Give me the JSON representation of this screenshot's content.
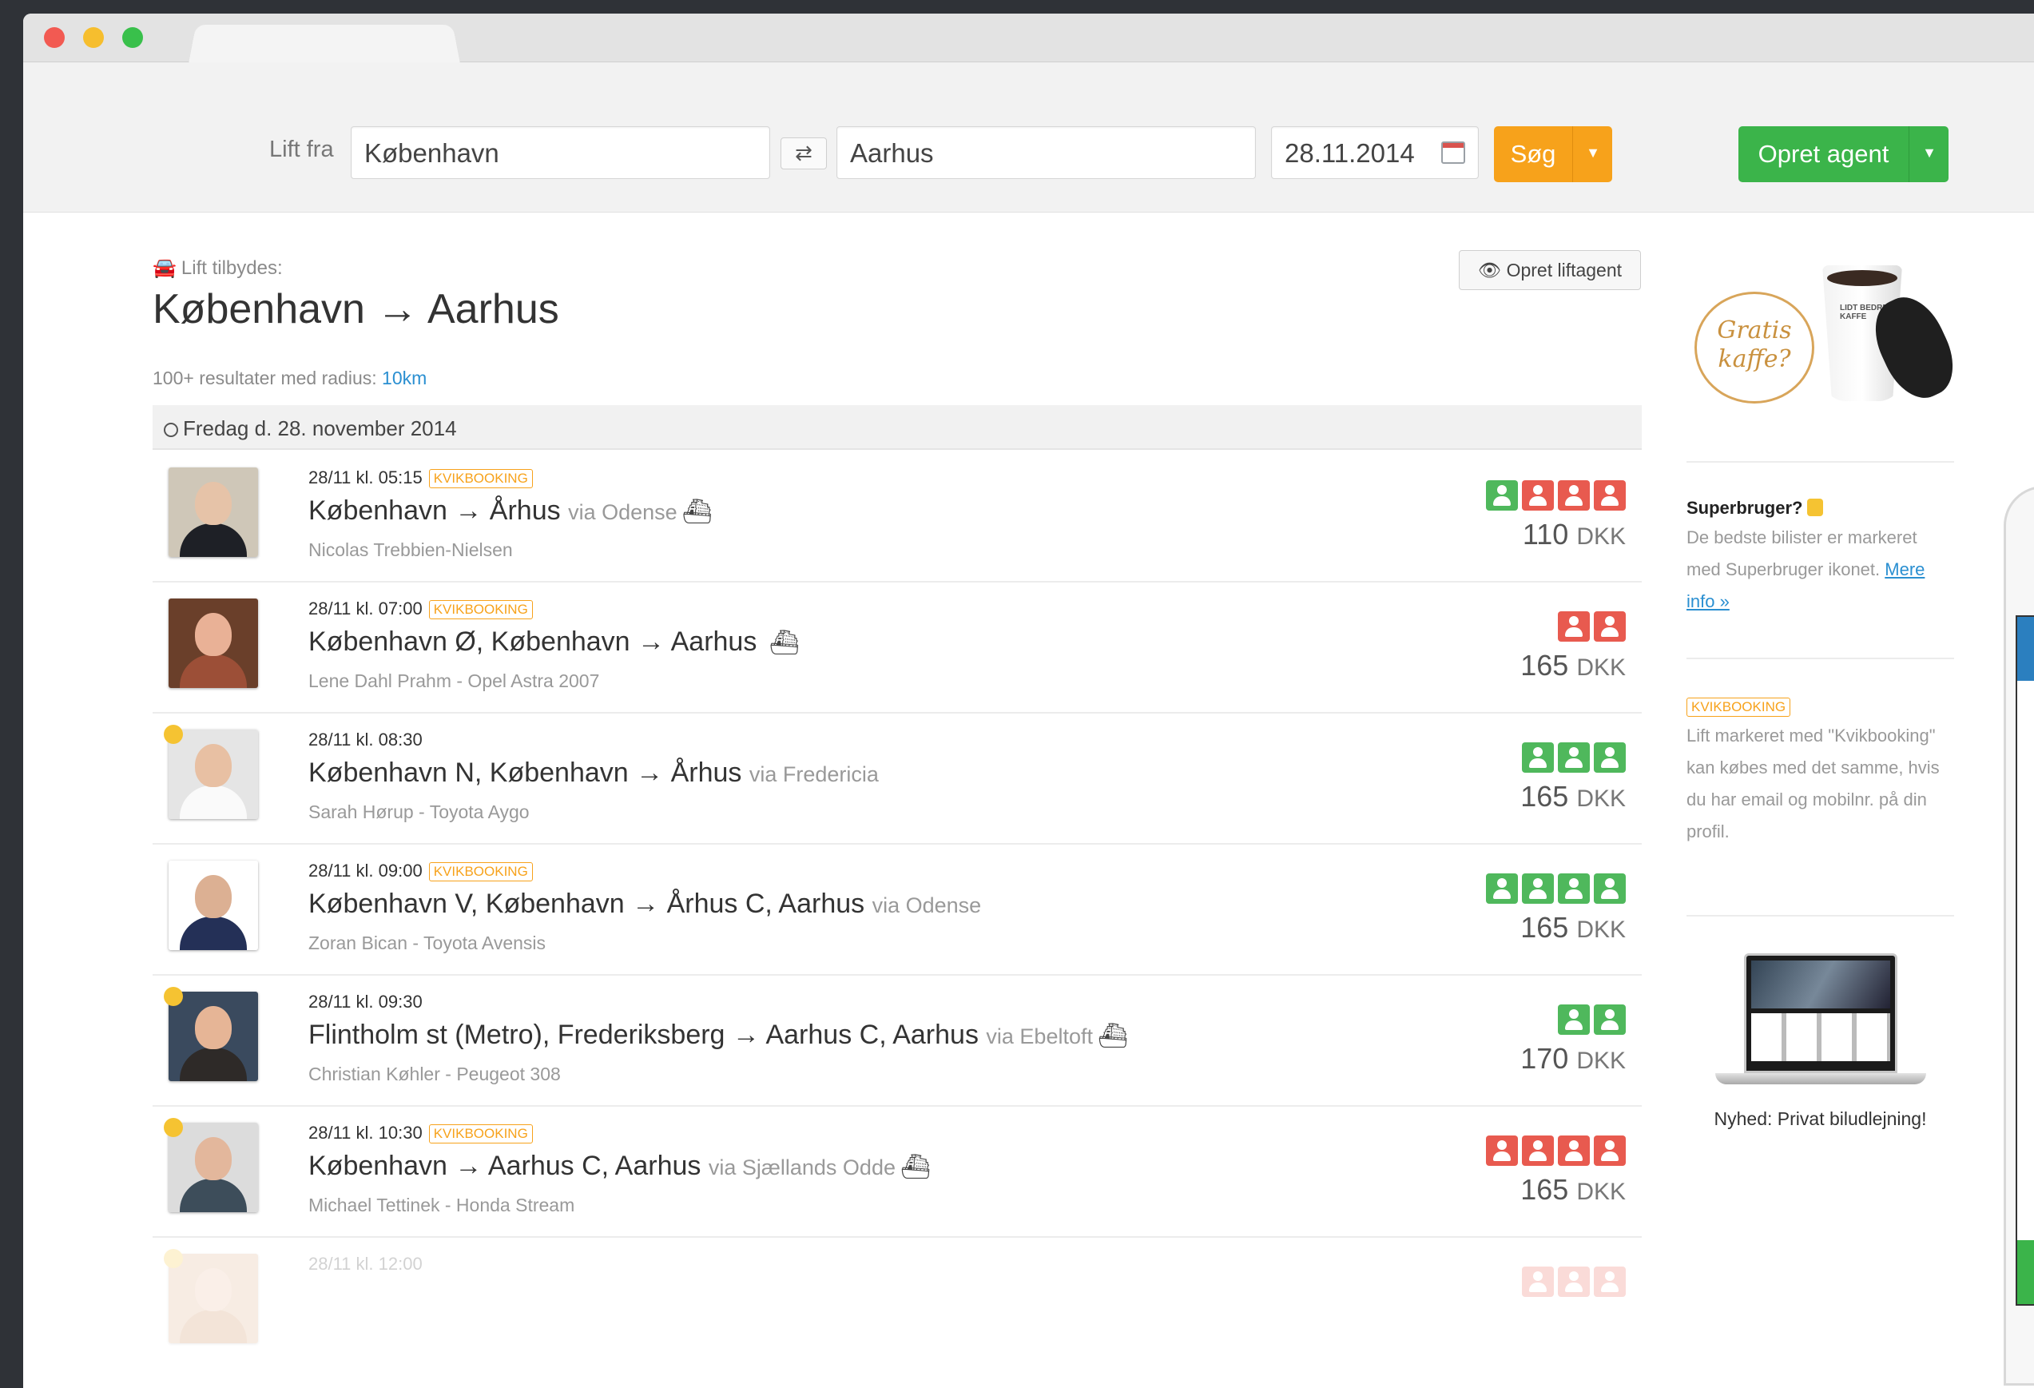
{
  "search": {
    "label": "Lift fra",
    "from_value": "København",
    "to_value": "Aarhus",
    "date_value": "28.11.2014",
    "search_label": "Søg",
    "agent_label": "Opret agent",
    "swap_icon": "⇄"
  },
  "header": {
    "offered_label": "Lift tilbydes:",
    "route_title": "København → Aarhus",
    "result_prefix": "100+ resultater med radius:",
    "radius": "10km",
    "liftagent_label": "Opret liftagent",
    "date_heading": "Fredag d. 28. november 2014"
  },
  "rides": [
    {
      "time": "28/11 kl. 05:15",
      "kvik": "KVIKBOOKING",
      "route": "København → Århus",
      "via": "via Odense",
      "ferry": true,
      "driver": "Nicolas Trebbien-Nielsen",
      "seats": [
        "free",
        "taken",
        "taken",
        "taken"
      ],
      "price": "110",
      "currency": "DKK",
      "super": false,
      "avatar_colors": {
        "bg": "#cfc7b8",
        "head": "#e6c3a8",
        "body": "#1e2026"
      }
    },
    {
      "time": "28/11 kl. 07:00",
      "kvik": "KVIKBOOKING",
      "route": "København Ø, København → Aarhus",
      "via": "",
      "ferry": true,
      "driver": "Lene Dahl Prahm - Opel Astra 2007",
      "seats": [
        "taken",
        "taken"
      ],
      "price": "165",
      "currency": "DKK",
      "super": false,
      "avatar_colors": {
        "bg": "#6a3f2a",
        "head": "#e9b196",
        "body": "#9c4f37"
      }
    },
    {
      "time": "28/11 kl. 08:30",
      "kvik": "",
      "route": "København N, København → Århus",
      "via": "via Fredericia",
      "ferry": false,
      "driver": "Sarah Hørup - Toyota Aygo",
      "seats": [
        "free",
        "free",
        "free"
      ],
      "price": "165",
      "currency": "DKK",
      "super": true,
      "avatar_colors": {
        "bg": "#e5e5e5",
        "head": "#e8c0a3",
        "body": "#fafafa"
      }
    },
    {
      "time": "28/11 kl. 09:00",
      "kvik": "KVIKBOOKING",
      "route": "København V, København → Århus C, Aarhus",
      "via": "via Odense",
      "ferry": false,
      "driver": "Zoran Bican - Toyota Avensis",
      "seats": [
        "free",
        "free",
        "free",
        "free"
      ],
      "price": "165",
      "currency": "DKK",
      "super": false,
      "avatar_colors": {
        "bg": "#ffffff",
        "head": "#dcb093",
        "body": "#243057"
      }
    },
    {
      "time": "28/11 kl. 09:30",
      "kvik": "",
      "route": "Flintholm st (Metro), Frederiksberg → Aarhus C, Aarhus",
      "via": "via Ebeltoft",
      "ferry": true,
      "driver": "Christian Køhler - Peugeot 308",
      "seats": [
        "free",
        "free"
      ],
      "price": "170",
      "currency": "DKK",
      "super": true,
      "avatar_colors": {
        "bg": "#3a4a5e",
        "head": "#e6b596",
        "body": "#2e2a28"
      }
    },
    {
      "time": "28/11 kl. 10:30",
      "kvik": "KVIKBOOKING",
      "route": "København → Aarhus C, Aarhus",
      "via": "via Sjællands Odde",
      "ferry": true,
      "driver": "Michael Tettinek - Honda Stream",
      "seats": [
        "taken",
        "taken",
        "taken",
        "taken"
      ],
      "price": "165",
      "currency": "DKK",
      "super": true,
      "avatar_colors": {
        "bg": "#dcdcdc",
        "head": "#e3b79c",
        "body": "#3d4d5a"
      }
    },
    {
      "time": "28/11 kl. 12:00",
      "kvik": "",
      "route": "",
      "via": "",
      "ferry": false,
      "driver": "",
      "seats": [
        "taken",
        "taken",
        "taken"
      ],
      "price": "",
      "currency": "",
      "super": true,
      "faded": true,
      "avatar_colors": {
        "bg": "#d9a97f",
        "head": "#e6b596",
        "body": "#c9834f"
      }
    }
  ],
  "sidebar": {
    "coffee_text": "Gratis kaffe?",
    "coffee_cup_text": "LIDT BEDRE KAFFE",
    "superbruger_title": "Superbruger?",
    "superbruger_text": "De bedste bilister er markeret med Superbruger ikonet.",
    "superbruger_link": "Mere info »",
    "kvik_badge": "KVIKBOOKING",
    "kvik_text": "Lift markeret med \"Kvikbooking\" kan købes med det samme, hvis du har email og mobilnr. på din profil.",
    "laptop_caption": "Nyhed: Privat biludlejning!"
  },
  "colors": {
    "accent_orange": "#f7a21b",
    "accent_green": "#3bb44a",
    "seat_free": "#4fb85c",
    "seat_taken": "#e85a4f",
    "link_blue": "#2a8fd1"
  }
}
